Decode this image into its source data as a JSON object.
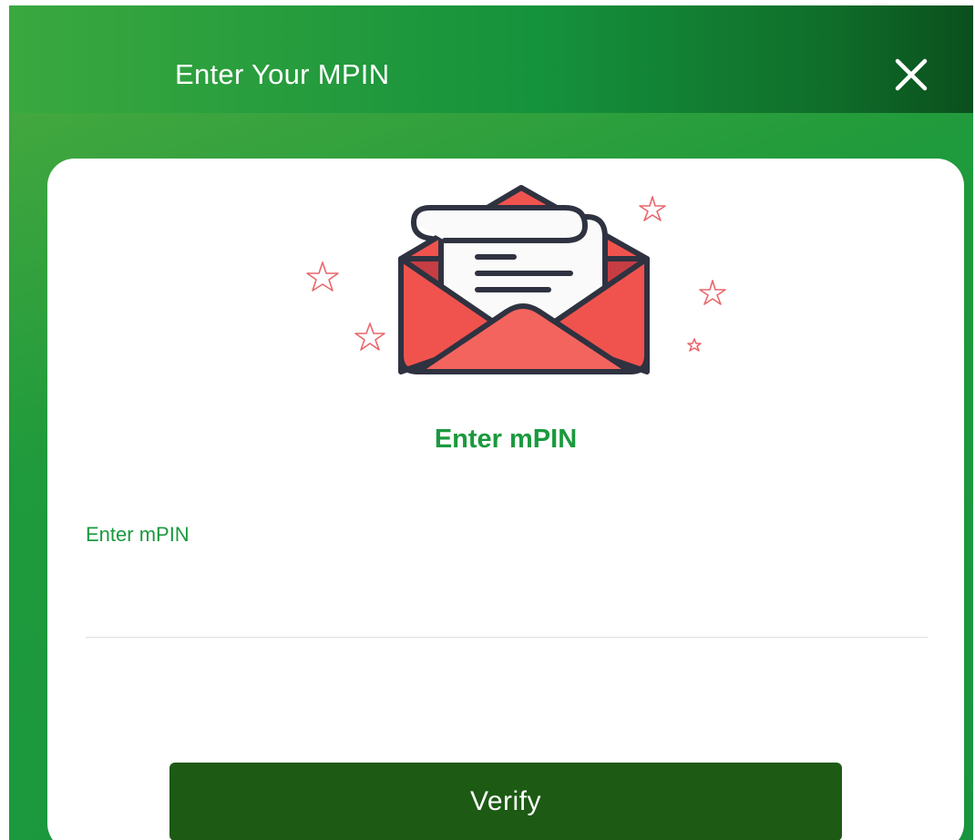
{
  "header": {
    "title": "Enter Your MPIN",
    "close_icon": "close-icon"
  },
  "card": {
    "illustration_icon": "open-envelope-letter-icon",
    "title": "Enter mPIN",
    "pin_field": {
      "label": "Enter mPIN",
      "value": ""
    },
    "verify_label": "Verify"
  },
  "colors": {
    "primary_green": "#1a9a3e",
    "header_dark_green": "#0b4f1d",
    "button_green": "#1d5a14",
    "envelope_red": "#f0534e",
    "star_red": "#e8676c"
  }
}
